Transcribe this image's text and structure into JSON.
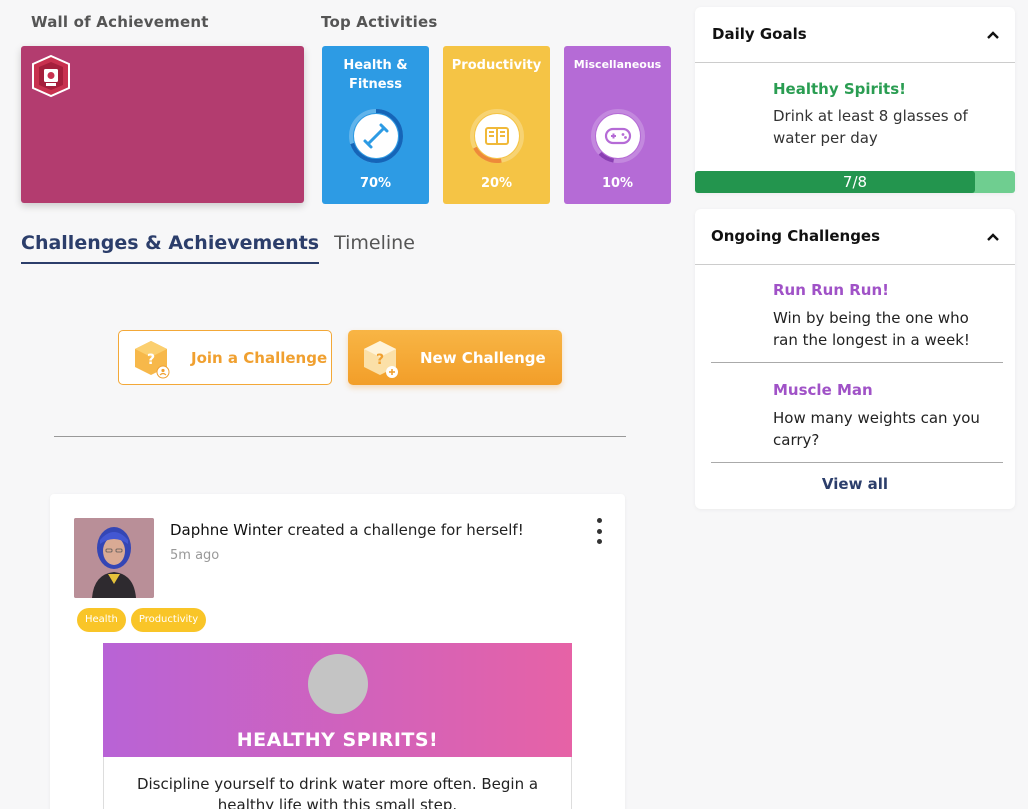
{
  "wall": {
    "title": "Wall of Achievement"
  },
  "activities": {
    "title": "Top Activities",
    "items": [
      {
        "label": "Health & Fitness",
        "percent": "70%",
        "value": 0.7,
        "color": "#2d9be4",
        "icon": "dumbbell-icon"
      },
      {
        "label": "Productivity",
        "percent": "20%",
        "value": 0.2,
        "color": "#f5c445",
        "icon": "book-icon"
      },
      {
        "label": "Miscellaneous",
        "percent": "10%",
        "value": 0.1,
        "color": "#b56bd6",
        "icon": "gamepad-icon"
      }
    ]
  },
  "tabs": [
    {
      "label": "Challenges & Achievements",
      "active": true
    },
    {
      "label": "Timeline",
      "active": false
    }
  ],
  "buttons": {
    "join": "Join a Challenge",
    "new": "New Challenge"
  },
  "post": {
    "author": "Daphne Winter",
    "action": " created a challenge for herself!",
    "time": "5m ago",
    "tags": [
      "Health",
      "Productivity"
    ],
    "challenge_title": "HEALTHY SPIRITS!",
    "challenge_desc": "Discipline yourself to drink water more often. Begin a healthy life with this small step."
  },
  "daily_goals": {
    "title": "Daily Goals",
    "goal_title": "Healthy Spirits!",
    "goal_desc": "Drink at least 8 glasses of water per day",
    "progress_label": "7/8",
    "progress_value": 0.875,
    "accent": "#2a9d52"
  },
  "ongoing": {
    "title": "Ongoing Challenges",
    "items": [
      {
        "title": "Run Run Run!",
        "desc": "Win by being the one who ran the longest in a week!"
      },
      {
        "title": "Muscle Man",
        "desc": "How many weights can you carry?"
      }
    ],
    "view_all": "View all"
  }
}
